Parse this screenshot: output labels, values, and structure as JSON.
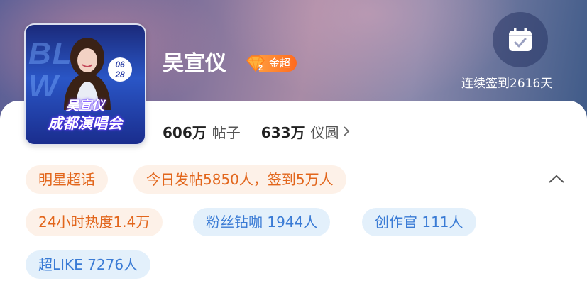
{
  "profile": {
    "name": "吴宣仪",
    "cover_date": "06 28",
    "cover_caption_line1": "吴宣仪",
    "cover_caption_line2": "成都演唱会",
    "badge_level": "金超",
    "badge_gem_number": "2"
  },
  "checkin": {
    "icon": "calendar-check-icon",
    "label": "连续签到2616天"
  },
  "stats": {
    "posts_count": "606万",
    "posts_label": "帖子",
    "coins_count": "633万",
    "coins_label": "仪圆"
  },
  "tags": {
    "category": "明星超话",
    "today": "今日发帖5850人，签到5万人",
    "heat": "24小时热度1.4万",
    "diamond_fans": "粉丝钻咖 1944人",
    "creators": "创作官 111人",
    "super_like": "超LIKE 7276人"
  },
  "colors": {
    "orange_tag_text": "#e2661c",
    "orange_tag_bg": "#fdf1e8",
    "blue_tag_text": "#3a7bd5",
    "blue_tag_bg": "#e3f0fb",
    "badge_orange": "#ff7a28"
  }
}
